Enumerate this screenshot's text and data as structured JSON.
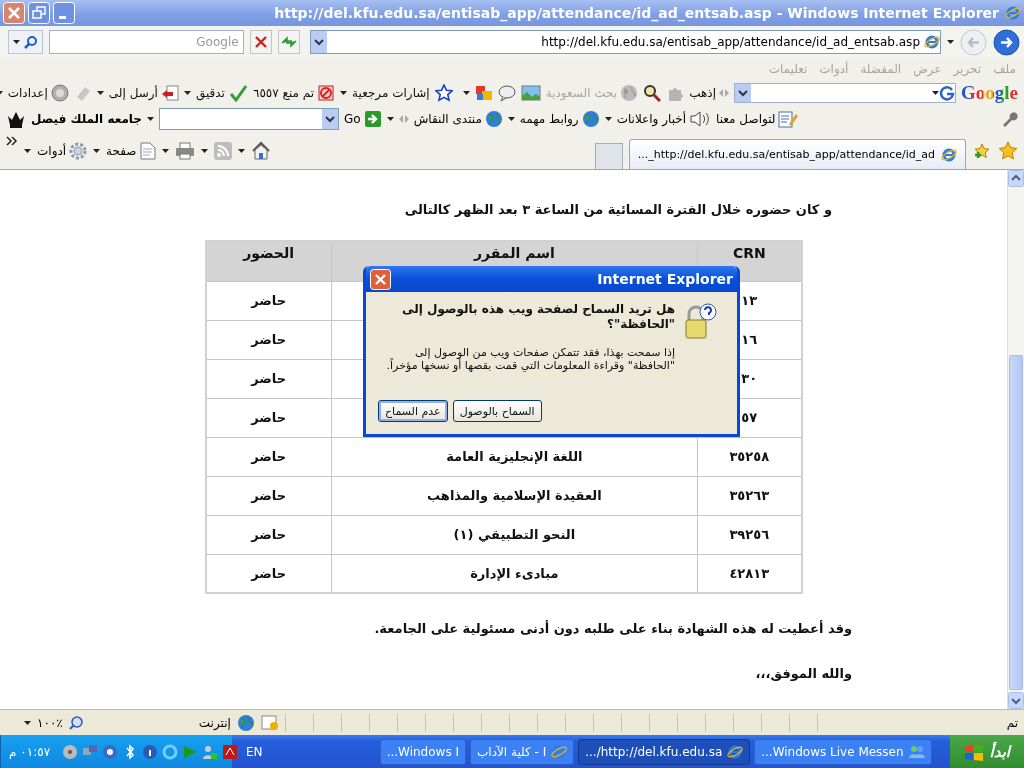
{
  "window": {
    "title": "http://del.kfu.edu.sa/entisab_app/attendance/id_ad_entsab.asp - Windows Internet Explorer"
  },
  "address_bar": {
    "search_placeholder": "Google",
    "url": "http://del.kfu.edu.sa/entisab_app/attendance/id_ad_entsab.asp"
  },
  "menu": [
    "ملف",
    "تحرير",
    "عرض",
    "المفضلة",
    "أدوات",
    "تعليمات"
  ],
  "google_toolbar": {
    "logo": "Google",
    "items": [
      {
        "label": "إذهب",
        "disabled": false
      },
      {
        "label": "بحث السعودية",
        "disabled": true
      },
      {
        "label": "إشارات مرجعية",
        "disabled": false
      },
      {
        "label": "تم منع ٦٥٥٧",
        "disabled": false
      },
      {
        "label": "تدقيق",
        "disabled": false
      },
      {
        "label": "أرسل إلى",
        "disabled": false
      },
      {
        "label": "إعدادات",
        "disabled": false
      }
    ]
  },
  "links_bar": {
    "items": [
      "لتواصل معنا",
      "أخبار واعلانات",
      "روابط مهمه",
      "منتدى النقاش"
    ],
    "go": "Go",
    "site": "جامعه الملك فيصل"
  },
  "tabs": [
    {
      "label": "..._http://del.kfu.edu.sa/entisab_app/attendance/id_ad",
      "selected": true
    }
  ],
  "command_bar": [
    "صفحة",
    "أدوات"
  ],
  "content": {
    "intro": "و كان حضوره خلال الفترة المسائية من الساعة ٣ بعد الظهر كالتالى",
    "table": {
      "columns": [
        "CRN",
        "اسم المقرر",
        "الحضور"
      ],
      "rows": [
        {
          "crn": "١٣",
          "attendance": "حاضر"
        },
        {
          "crn": "١٦",
          "attendance": "حاضر"
        },
        {
          "crn": "٣٠",
          "attendance": "حاضر"
        },
        {
          "crn": "٥٧",
          "attendance": "حاضر"
        },
        {
          "crn": "٣٥٢٥٨",
          "course": "اللغة الإنجليزية العامة",
          "attendance": "حاضر"
        },
        {
          "crn": "٣٥٢٦٣",
          "course": "العقيدة الإسلامية والمذاهب",
          "attendance": "حاضر"
        },
        {
          "crn": "٣٩٢٥٦",
          "course": "النحو التطبيقي (١)",
          "attendance": "حاضر"
        },
        {
          "crn": "٤٢٨١٣",
          "course": "مبادىء الإدارة",
          "attendance": "حاضر"
        }
      ]
    },
    "closing": "وقد أعطيت له هذه الشهادة بناء على طلبه دون أدنى مسئولية على الجامعة.",
    "signoff": "والله الموفق،،،"
  },
  "dialog": {
    "title": "Internet Explorer",
    "question": "هل تريد السماح لصفحة ويب هذه بالوصول إلى \"الحافظة\"؟",
    "message": "إذا سمحت بهذا، فقد تتمكن صفحات ويب من الوصول إلى \"الحافظة\" وقراءة المعلومات التي قمت بقصها أو نسخها مؤخراً.",
    "buttons": [
      {
        "label": "السماح بالوصول",
        "focused": false
      },
      {
        "label": "عدم السماح",
        "focused": true
      }
    ]
  },
  "status_bar": {
    "status": "تم",
    "zone": "إنترنت",
    "zoom": "١٠٠٪"
  },
  "taskbar": {
    "start": "ابدأ",
    "tasks": [
      {
        "label": "...Windows Live Messen",
        "selected": false
      },
      {
        "label": ".../http://del.kfu.edu.sa",
        "selected": true
      },
      {
        "label": "كلية الآداب - I",
        "selected": false
      },
      {
        "label": "...Windows I",
        "selected": false
      }
    ],
    "language": "EN",
    "clock": "٠١:٥٧ م"
  }
}
